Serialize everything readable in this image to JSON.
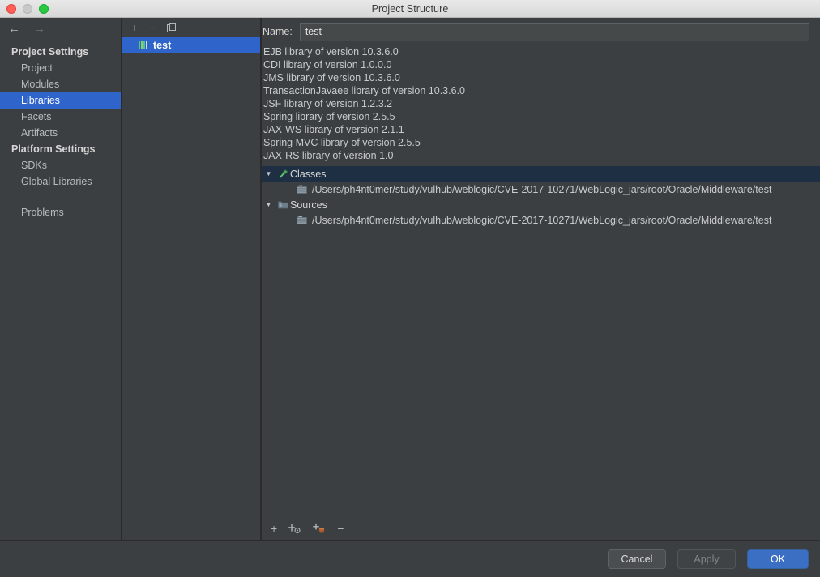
{
  "window": {
    "title": "Project Structure",
    "traffic_lights": [
      "close-red",
      "minimize-gray",
      "zoom-green"
    ]
  },
  "nav": {
    "back_icon": "←",
    "forward_icon": "→"
  },
  "sidebar": {
    "groups": [
      {
        "label": "Project Settings",
        "items": [
          {
            "label": "Project",
            "selected": false
          },
          {
            "label": "Modules",
            "selected": false
          },
          {
            "label": "Libraries",
            "selected": true
          },
          {
            "label": "Facets",
            "selected": false
          },
          {
            "label": "Artifacts",
            "selected": false
          }
        ]
      },
      {
        "label": "Platform Settings",
        "items": [
          {
            "label": "SDKs",
            "selected": false
          },
          {
            "label": "Global Libraries",
            "selected": false
          }
        ]
      }
    ],
    "problems_label": "Problems",
    "help_label": "?"
  },
  "mid_pane": {
    "toolbar": [
      {
        "name": "add-library-button",
        "glyph": "+"
      },
      {
        "name": "remove-library-button",
        "glyph": "−"
      },
      {
        "name": "copy-library-button",
        "glyph": "⧉"
      }
    ],
    "libraries": [
      {
        "label": "test",
        "icon": "library-icon",
        "selected": true
      }
    ]
  },
  "right_pane": {
    "name_label": "Name:",
    "name_value": "test",
    "name_placeholder": "",
    "detail_lines": [
      "EJB library of version 10.3.6.0",
      "CDI library of version 1.0.0.0",
      "JMS library of version 10.3.6.0",
      "TransactionJavaee library of version 10.3.6.0",
      "JSF library of version 1.2.3.2",
      "Spring library of version 2.5.5",
      "JAX-WS library of version 2.1.1",
      "Spring MVC library of version 2.5.5",
      "JAX-RS library of version 1.0"
    ],
    "tree": [
      {
        "label": "Classes",
        "icon": "hammer-icon",
        "expanded": true,
        "highlighted": true,
        "twisty": "▼",
        "children": [
          {
            "path": "/Users/ph4nt0mer/study/vulhub/weblogic/CVE-2017-10271/WebLogic_jars/root/Oracle/Middleware/test",
            "icon": "folder-classes-icon"
          }
        ]
      },
      {
        "label": "Sources",
        "icon": "folder-sources-icon",
        "expanded": true,
        "highlighted": false,
        "twisty": "▼",
        "children": [
          {
            "path": "/Users/ph4nt0mer/study/vulhub/weblogic/CVE-2017-10271/WebLogic_jars/root/Oracle/Middleware/test",
            "icon": "folder-sources-child-icon"
          }
        ]
      }
    ],
    "bottom_toolbar": [
      {
        "name": "add-root-button",
        "glyph": "+"
      },
      {
        "name": "add-from-config-button",
        "glyph": "+"
      },
      {
        "name": "add-jar-button",
        "glyph": "+"
      },
      {
        "name": "remove-root-button",
        "glyph": "−"
      }
    ]
  },
  "footer": {
    "cancel_label": "Cancel",
    "apply_label": "Apply",
    "apply_disabled": true,
    "ok_label": "OK"
  },
  "colors": {
    "window_bg": "#3c3f41",
    "titlebar_bg": "#e3e3e3",
    "selection_blue": "#2f65ca",
    "tree_highlight": "#1e2f44",
    "primary_button": "#3b6fc4",
    "text": "#d6d6d6"
  }
}
